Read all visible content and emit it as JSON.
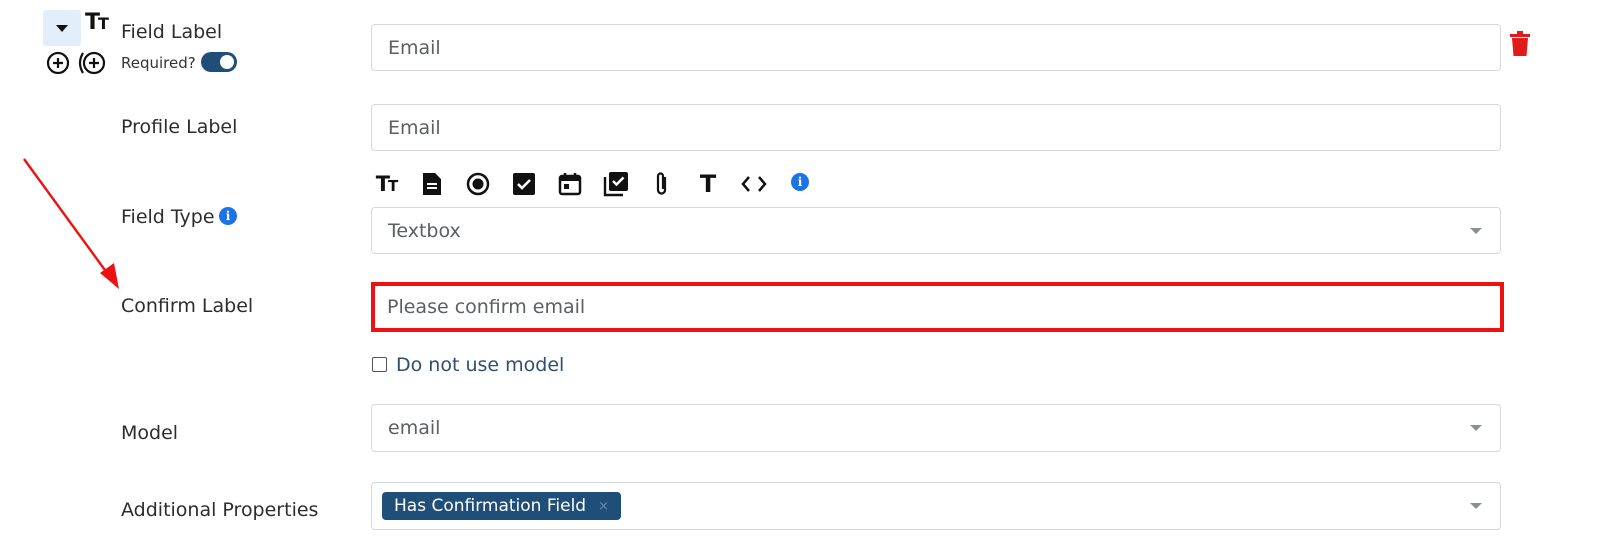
{
  "field": {
    "label_caption": "Field Label",
    "label_value": "Email",
    "required_label": "Required?",
    "required_on": true
  },
  "profile": {
    "caption": "Profile Label",
    "value": "Email"
  },
  "field_type": {
    "caption": "Field Type",
    "selected": "Textbox",
    "type_icons": [
      "text-size-icon",
      "document-icon",
      "radio-icon",
      "checkbox-icon",
      "calendar-icon",
      "checklist-icon",
      "attachment-icon",
      "text-icon",
      "code-icon",
      "info-icon"
    ]
  },
  "confirm": {
    "caption": "Confirm Label",
    "value": "Please confirm email",
    "highlight_color": "#ee1111"
  },
  "model_option": {
    "label": "Do not use model",
    "checked": false
  },
  "model": {
    "caption": "Model",
    "selected": "email"
  },
  "additional": {
    "caption": "Additional Properties",
    "tags": [
      "Has Confirmation Field"
    ]
  },
  "colors": {
    "primary": "#1f4e79",
    "delete": "#e01b1b",
    "info": "#1a73e8",
    "arrow": "#ee1111"
  }
}
